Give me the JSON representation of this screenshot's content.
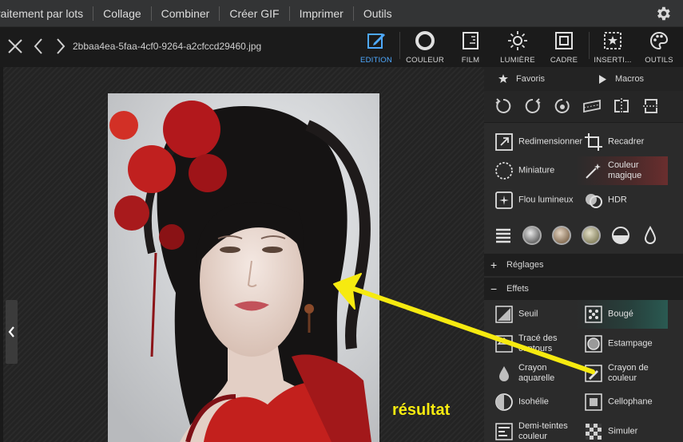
{
  "menu": [
    "raitement par lots",
    "Collage",
    "Combiner",
    "Créer GIF",
    "Imprimer",
    "Outils"
  ],
  "file": {
    "name": "2bbaa4ea-5faa-4cf0-9264-a2cfccd29460.jpg"
  },
  "tools": {
    "edition": "EDITION",
    "couleur": "COULEUR",
    "film": "FILM",
    "lumiere": "LUMIÈRE",
    "cadre": "CADRE",
    "insertion": "INSERTI...",
    "outils": "OUTILS"
  },
  "panel": {
    "favoris": "Favoris",
    "macros": "Macros",
    "features": {
      "redimensionner": "Redimensionner",
      "recadrer": "Recadrer",
      "miniature": "Miniature",
      "couleur_magique": "Couleur magique",
      "flou_lumineux": "Flou lumineux",
      "hdr": "HDR"
    },
    "reglages": "Réglages",
    "effets": "Effets",
    "effects": {
      "seuil": "Seuil",
      "bouge": "Bougé",
      "trace": "Tracé des contours",
      "estampage": "Estampage",
      "crayon_aquarelle": "Crayon aquarelle",
      "crayon_couleur": "Crayon de couleur",
      "isohelie": "Isohélie",
      "cellophane": "Cellophane",
      "demi_teintes": "Demi-teintes couleur",
      "simuler": "Simuler"
    }
  },
  "annotation": {
    "text": "résultat",
    "color": "#f6ea10"
  },
  "colors": {
    "accent": "#4ea9ff",
    "panel": "#2b2b2b"
  }
}
